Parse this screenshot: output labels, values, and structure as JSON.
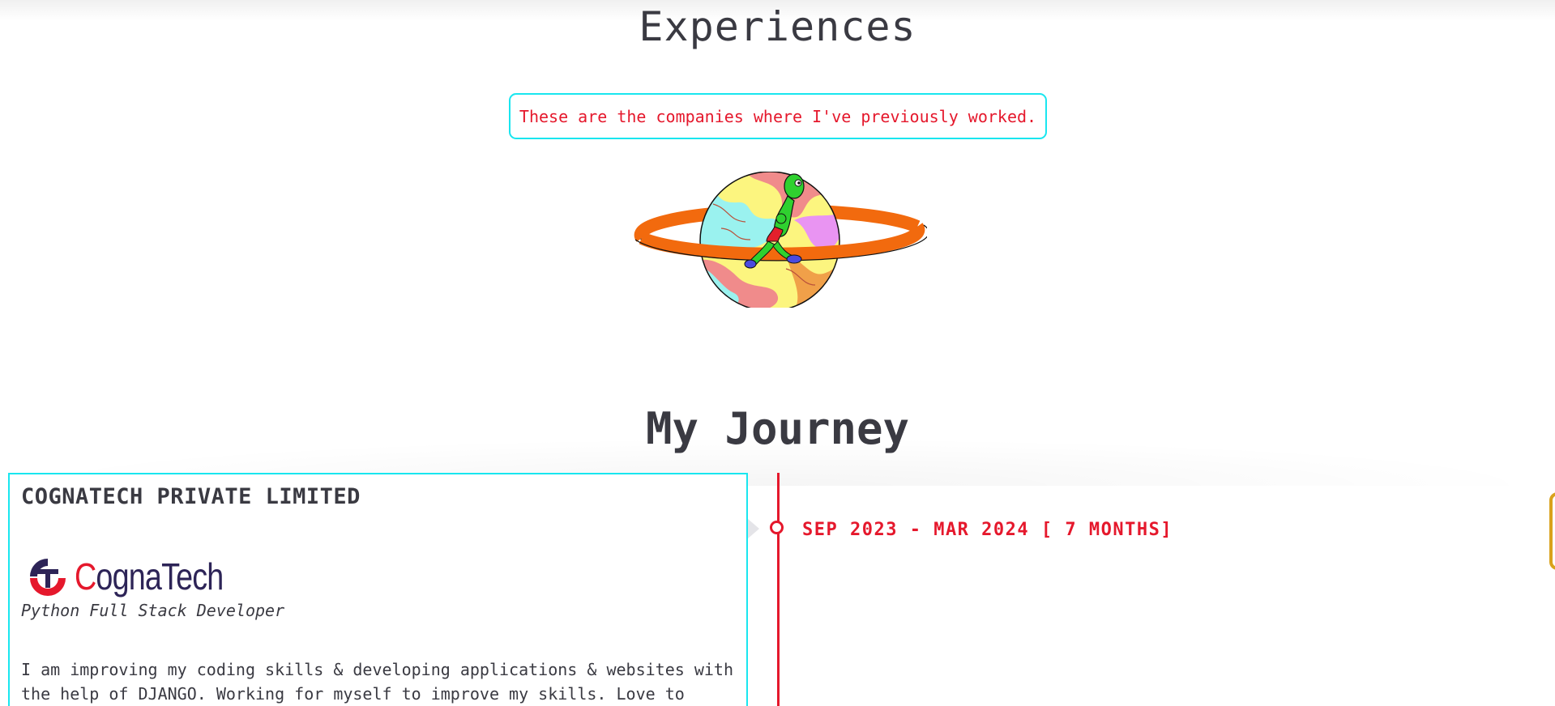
{
  "experiences": {
    "title": "Experiences",
    "subtitle": "These are the companies where I've previously worked."
  },
  "journey": {
    "title": "My Journey",
    "entries": [
      {
        "company": "COGNATECH PRIVATE LIMITED",
        "logo_text": "CognaTech",
        "logo_text_first": "C",
        "logo_text_rest": "ognaTech",
        "role": "Python Full Stack Developer",
        "description": "I am improving my coding skills & developing applications & websites with the help of DJANGO. Working for myself to improve my skills. Love to",
        "date": "SEP 2023 - MAR 2024 [ 7 MONTHS]"
      }
    ]
  },
  "colors": {
    "accent_red": "#e5182c",
    "border_cyan": "#19e6ef",
    "text_dark": "#3a3a42",
    "logo_navy": "#2d2457",
    "side_tab_gold": "#d9a21c"
  },
  "icons": {
    "planet_illustration": "alien-on-planet-icon",
    "logo_mark": "cognatech-logo-icon",
    "timeline_marker": "timeline-dot-icon"
  }
}
